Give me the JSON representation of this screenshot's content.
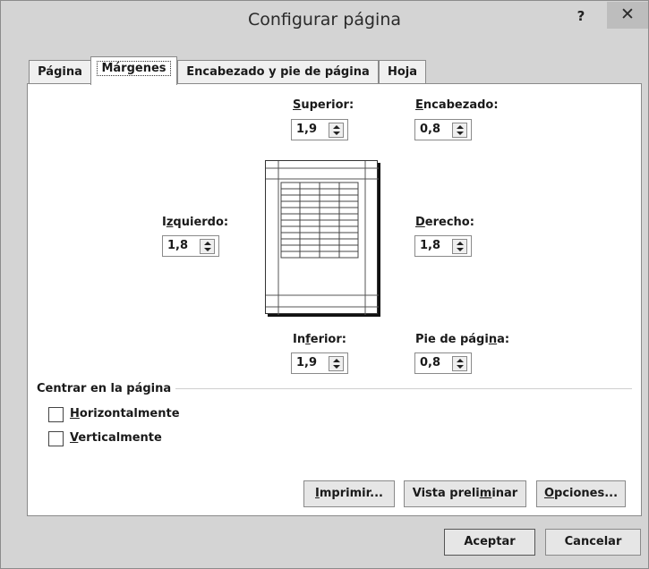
{
  "window": {
    "title": "Configurar página",
    "help": "?",
    "close": "✕"
  },
  "tabs": [
    {
      "label": "Página"
    },
    {
      "label": "Márgenes"
    },
    {
      "label": "Encabezado y pie de página"
    },
    {
      "label": "Hoja"
    }
  ],
  "margins": {
    "superior": {
      "label_pre": "",
      "label_key": "S",
      "label_post": "uperior:",
      "value": "1,9"
    },
    "encabezado": {
      "label_pre": "",
      "label_key": "E",
      "label_post": "ncabezado:",
      "value": "0,8"
    },
    "izquierdo": {
      "label_pre": "I",
      "label_key": "z",
      "label_post": "quierdo:",
      "value": "1,8"
    },
    "derecho": {
      "label_pre": "",
      "label_key": "D",
      "label_post": "erecho:",
      "value": "1,8"
    },
    "inferior": {
      "label_pre": "In",
      "label_key": "f",
      "label_post": "erior:",
      "value": "1,9"
    },
    "pie": {
      "label_pre": "Pie de pági",
      "label_key": "n",
      "label_post": "a:",
      "value": "0,8"
    }
  },
  "center": {
    "group_label": "Centrar en la página",
    "horizontal": {
      "key": "H",
      "rest": "orizontalmente",
      "checked": false
    },
    "vertical": {
      "key": "V",
      "rest": "erticalmente",
      "checked": false
    }
  },
  "buttons": {
    "imprimir": {
      "key": "I",
      "rest": "mprimir..."
    },
    "vista_pre": "Vista preli",
    "vista_key": "m",
    "vista_post": "inar",
    "opciones": {
      "key": "O",
      "rest": "pciones..."
    },
    "aceptar": "Aceptar",
    "cancelar": "Cancelar"
  }
}
